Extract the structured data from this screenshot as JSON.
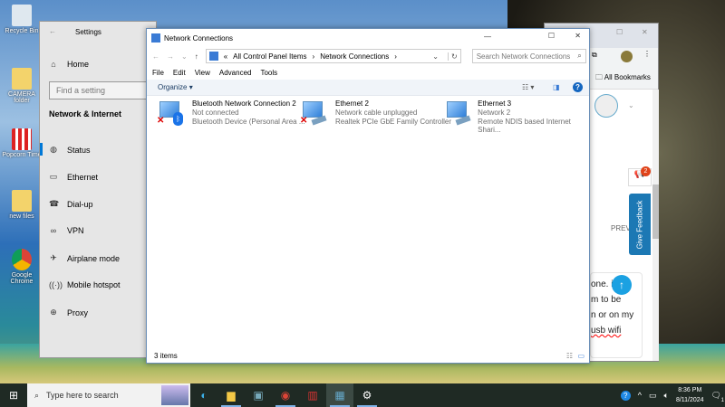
{
  "desktop": {
    "icons": [
      "Recycle Bin",
      "CAMERA folder",
      "Popcorn Time",
      "new files",
      "Google Chrome"
    ]
  },
  "settings": {
    "title": "Settings",
    "home": "Home",
    "search_placeholder": "Find a setting",
    "section": "Network & Internet",
    "items": [
      {
        "label": "Status",
        "icon": "globe-status-icon"
      },
      {
        "label": "Ethernet",
        "icon": "ethernet-icon"
      },
      {
        "label": "Dial-up",
        "icon": "dialup-icon"
      },
      {
        "label": "VPN",
        "icon": "vpn-icon"
      },
      {
        "label": "Airplane mode",
        "icon": "airplane-icon"
      },
      {
        "label": "Mobile hotspot",
        "icon": "hotspot-icon"
      },
      {
        "label": "Proxy",
        "icon": "proxy-globe-icon"
      }
    ],
    "selected": "Status"
  },
  "chrome": {
    "bookmarks": "All Bookmarks",
    "prev": "PREV",
    "feedback": "Give Feedback",
    "badge": "2",
    "text_lines": [
      "one. i",
      "m to be",
      "n or on my",
      "usb wifi"
    ]
  },
  "nc": {
    "title": "Network Connections",
    "breadcrumb": [
      "«",
      "All Control Panel Items",
      "Network Connections"
    ],
    "search_placeholder": "Search Network Connections",
    "menu": [
      "File",
      "Edit",
      "View",
      "Advanced",
      "Tools"
    ],
    "organize": "Organize",
    "items": [
      {
        "name": "Bluetooth Network Connection 2",
        "status": "Not connected",
        "device": "Bluetooth Device (Personal Area ...",
        "error": true
      },
      {
        "name": "Ethernet 2",
        "status": "Network cable unplugged",
        "device": "Realtek PCIe GbE Family Controller",
        "error": true
      },
      {
        "name": "Ethernet 3",
        "status": "Network 2",
        "device": "Remote NDIS based Internet Shari...",
        "error": false
      }
    ],
    "status": "3 items"
  },
  "taskbar": {
    "search_placeholder": "Type here to search",
    "time": "8:36 PM",
    "date": "8/11/2024",
    "notifications": "1"
  }
}
